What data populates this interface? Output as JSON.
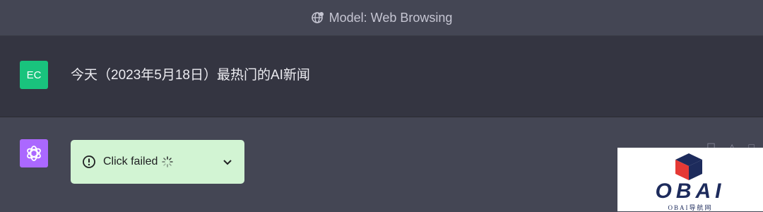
{
  "header": {
    "title": "Model: Web Browsing",
    "icon": "globe-plugin-icon"
  },
  "conversation": {
    "user": {
      "avatar_initials": "EC",
      "avatar_color": "#19c37d",
      "message": "今天（2023年5月18日）最热门的AI新闻"
    },
    "assistant": {
      "avatar_icon": "openai-logo-icon",
      "avatar_color": "#ab68ff",
      "status": {
        "label": "Click failed",
        "status_icon": "alert-circle-icon",
        "loading_icon": "spinner-icon",
        "expand_icon": "chevron-down-icon",
        "background": "#d2f4d3"
      }
    }
  },
  "watermark": {
    "logo_text": "OBAI",
    "subtitle": "OBAI导航网"
  }
}
